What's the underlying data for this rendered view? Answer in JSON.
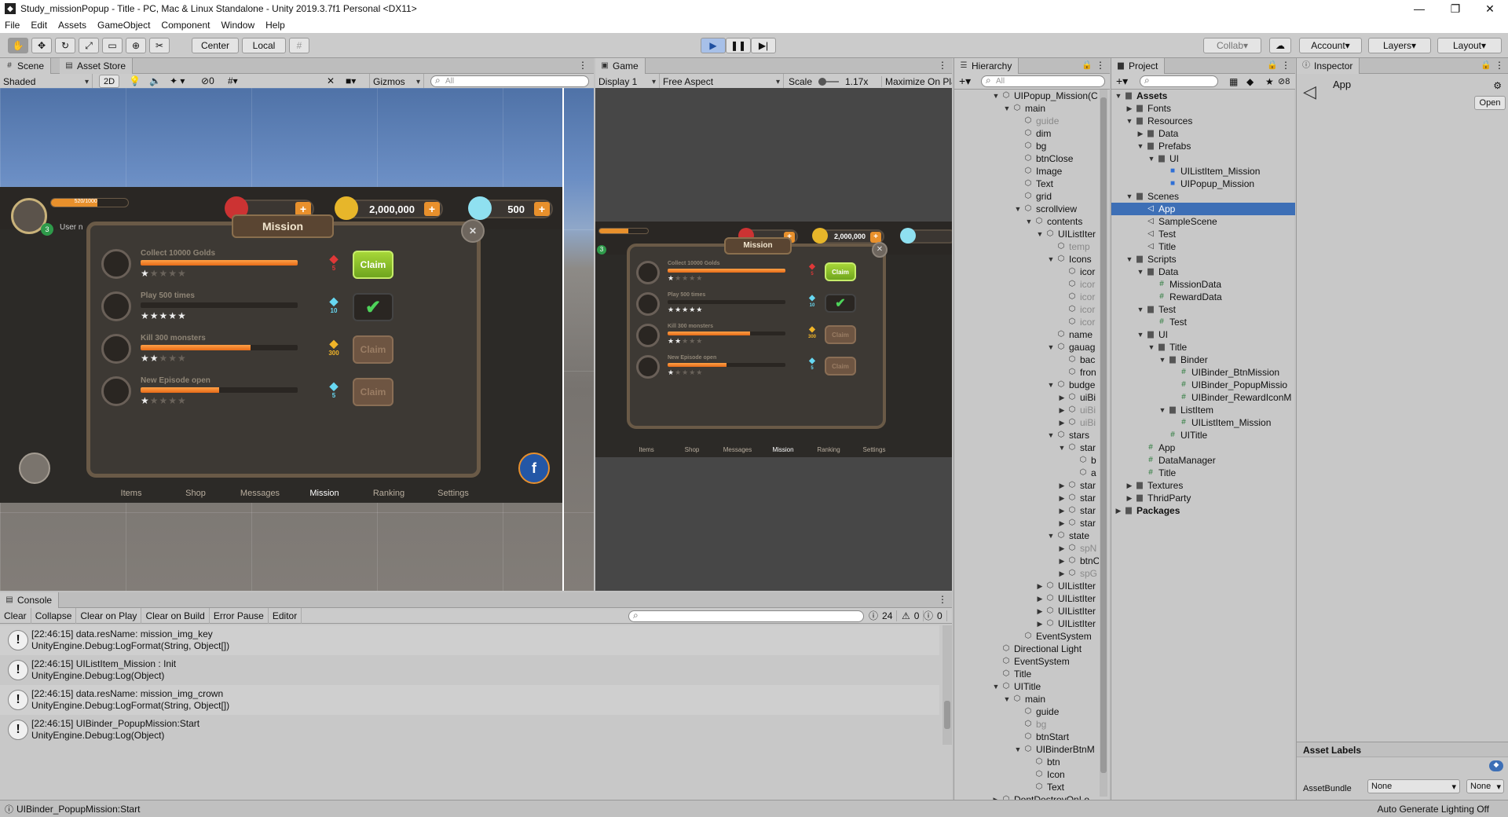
{
  "window": {
    "title": "Study_missionPopup - Title - PC, Mac & Linux Standalone - Unity 2019.3.7f1 Personal <DX11>"
  },
  "menu": [
    "File",
    "Edit",
    "Assets",
    "GameObject",
    "Component",
    "Window",
    "Help"
  ],
  "toolbar": {
    "pivot": "Center",
    "space": "Local",
    "collab": "Collab",
    "account": "Account",
    "layers": "Layers",
    "layout": "Layout"
  },
  "scene": {
    "tab": "Scene",
    "tab2": "Asset Store",
    "shading": "Shaded",
    "mode2d": "2D",
    "hidden": "0",
    "gizmos": "Gizmos",
    "search": "All"
  },
  "game": {
    "tab": "Game",
    "display": "Display 1",
    "aspect": "Free Aspect",
    "scale_label": "Scale",
    "scale_value": "1.17x",
    "maximize": "Maximize On Pla"
  },
  "ui_preview": {
    "gold": "2,000,000",
    "gems": "500",
    "hp": "520/1000",
    "level": "3",
    "username": "User n",
    "popup_title": "Mission",
    "missions": [
      {
        "name": "Collect 10000 Golds",
        "progress": 1.0,
        "stars": 1,
        "reward": "5",
        "button": "Claim",
        "state": "on"
      },
      {
        "name": "Play 500 times",
        "progress": 0.0,
        "stars": 5,
        "reward": "10",
        "button": "",
        "state": "done"
      },
      {
        "name": "Kill 300 monsters",
        "progress": 0.7,
        "stars": 2,
        "reward": "300",
        "button": "Claim",
        "state": "off"
      },
      {
        "name": "New Episode open",
        "progress": 0.5,
        "stars": 1,
        "reward": "5",
        "button": "Claim",
        "state": "off"
      }
    ],
    "nav": [
      "Items",
      "Shop",
      "Messages",
      "Mission",
      "Ranking",
      "Settings"
    ]
  },
  "hierarchy": {
    "tab": "Hierarchy",
    "search": "All",
    "items": [
      {
        "label": "UIPopup_Mission(C",
        "d": 0,
        "arrow": "open"
      },
      {
        "label": "main",
        "d": 1,
        "arrow": "open"
      },
      {
        "label": "guide",
        "d": 2,
        "dim": true
      },
      {
        "label": "dim",
        "d": 2
      },
      {
        "label": "bg",
        "d": 2
      },
      {
        "label": "btnClose",
        "d": 2
      },
      {
        "label": "Image",
        "d": 2
      },
      {
        "label": "Text",
        "d": 2
      },
      {
        "label": "grid",
        "d": 2
      },
      {
        "label": "scrollview",
        "d": 2,
        "arrow": "open"
      },
      {
        "label": "contents",
        "d": 3,
        "arrow": "open"
      },
      {
        "label": "UIListIter",
        "d": 4,
        "arrow": "open"
      },
      {
        "label": "temp",
        "d": 5,
        "dim": true
      },
      {
        "label": "Icons",
        "d": 5,
        "arrow": "open"
      },
      {
        "label": "icor",
        "d": 6
      },
      {
        "label": "icor",
        "d": 6,
        "dim": true
      },
      {
        "label": "icor",
        "d": 6,
        "dim": true
      },
      {
        "label": "icor",
        "d": 6,
        "dim": true
      },
      {
        "label": "icor",
        "d": 6,
        "dim": true
      },
      {
        "label": "name",
        "d": 5
      },
      {
        "label": "gauag",
        "d": 5,
        "arrow": "open"
      },
      {
        "label": "bac",
        "d": 6
      },
      {
        "label": "fron",
        "d": 6
      },
      {
        "label": "budge",
        "d": 5,
        "arrow": "open"
      },
      {
        "label": "uiBi",
        "d": 6,
        "arrow": "closed"
      },
      {
        "label": "uiBi",
        "d": 6,
        "arrow": "closed",
        "dim": true
      },
      {
        "label": "uiBi",
        "d": 6,
        "arrow": "closed",
        "dim": true
      },
      {
        "label": "stars",
        "d": 5,
        "arrow": "open"
      },
      {
        "label": "star",
        "d": 6,
        "arrow": "open"
      },
      {
        "label": "b",
        "d": 7
      },
      {
        "label": "a",
        "d": 7
      },
      {
        "label": "star",
        "d": 6,
        "arrow": "closed"
      },
      {
        "label": "star",
        "d": 6,
        "arrow": "closed"
      },
      {
        "label": "star",
        "d": 6,
        "arrow": "closed"
      },
      {
        "label": "star",
        "d": 6,
        "arrow": "closed"
      },
      {
        "label": "state",
        "d": 5,
        "arrow": "open"
      },
      {
        "label": "spN",
        "d": 6,
        "arrow": "closed",
        "dim": true
      },
      {
        "label": "btnC",
        "d": 6,
        "arrow": "closed"
      },
      {
        "label": "spG",
        "d": 6,
        "arrow": "closed",
        "dim": true
      },
      {
        "label": "UIListIter",
        "d": 4,
        "arrow": "closed"
      },
      {
        "label": "UIListIter",
        "d": 4,
        "arrow": "closed"
      },
      {
        "label": "UIListIter",
        "d": 4,
        "arrow": "closed"
      },
      {
        "label": "UIListIter",
        "d": 4,
        "arrow": "closed"
      },
      {
        "label": "EventSystem",
        "d": 2
      },
      {
        "label": "Directional Light",
        "d": 0
      },
      {
        "label": "EventSystem",
        "d": 0
      },
      {
        "label": "Title",
        "d": 0
      },
      {
        "label": "UITitle",
        "d": 0,
        "arrow": "open"
      },
      {
        "label": "main",
        "d": 1,
        "arrow": "open"
      },
      {
        "label": "guide",
        "d": 2
      },
      {
        "label": "bg",
        "d": 2,
        "dim": true
      },
      {
        "label": "btnStart",
        "d": 2
      },
      {
        "label": "UIBinderBtnM",
        "d": 2,
        "arrow": "open"
      },
      {
        "label": "btn",
        "d": 3
      },
      {
        "label": "Icon",
        "d": 3
      },
      {
        "label": "Text",
        "d": 3
      },
      {
        "label": "DontDestroyOnLo",
        "d": 0,
        "arrow": "closed"
      }
    ]
  },
  "project": {
    "tab": "Project",
    "hidden_count": "8",
    "items": [
      {
        "label": "Assets",
        "d": 0,
        "arrow": "open",
        "kind": "folder",
        "bold": true
      },
      {
        "label": "Fonts",
        "d": 1,
        "arrow": "closed",
        "kind": "folder"
      },
      {
        "label": "Resources",
        "d": 1,
        "arrow": "open",
        "kind": "folder"
      },
      {
        "label": "Data",
        "d": 2,
        "arrow": "closed",
        "kind": "folder"
      },
      {
        "label": "Prefabs",
        "d": 2,
        "arrow": "open",
        "kind": "folder"
      },
      {
        "label": "UI",
        "d": 3,
        "arrow": "open",
        "kind": "folder"
      },
      {
        "label": "UIListItem_Mission",
        "d": 4,
        "kind": "prefab"
      },
      {
        "label": "UIPopup_Mission",
        "d": 4,
        "kind": "prefab"
      },
      {
        "label": "Scenes",
        "d": 1,
        "arrow": "open",
        "kind": "folder"
      },
      {
        "label": "App",
        "d": 2,
        "kind": "scene",
        "sel": true
      },
      {
        "label": "SampleScene",
        "d": 2,
        "kind": "scene"
      },
      {
        "label": "Test",
        "d": 2,
        "kind": "scene"
      },
      {
        "label": "Title",
        "d": 2,
        "kind": "scene"
      },
      {
        "label": "Scripts",
        "d": 1,
        "arrow": "open",
        "kind": "folder"
      },
      {
        "label": "Data",
        "d": 2,
        "arrow": "open",
        "kind": "folder"
      },
      {
        "label": "MissionData",
        "d": 3,
        "kind": "script"
      },
      {
        "label": "RewardData",
        "d": 3,
        "kind": "script"
      },
      {
        "label": "Test",
        "d": 2,
        "arrow": "open",
        "kind": "folder"
      },
      {
        "label": "Test",
        "d": 3,
        "kind": "script"
      },
      {
        "label": "UI",
        "d": 2,
        "arrow": "open",
        "kind": "folder"
      },
      {
        "label": "Title",
        "d": 3,
        "arrow": "open",
        "kind": "folder"
      },
      {
        "label": "Binder",
        "d": 4,
        "arrow": "open",
        "kind": "folder"
      },
      {
        "label": "UIBinder_BtnMission",
        "d": 5,
        "kind": "script"
      },
      {
        "label": "UIBinder_PopupMissio",
        "d": 5,
        "kind": "script"
      },
      {
        "label": "UIBinder_RewardIconM",
        "d": 5,
        "kind": "script"
      },
      {
        "label": "ListItem",
        "d": 4,
        "arrow": "open",
        "kind": "folder"
      },
      {
        "label": "UIListItem_Mission",
        "d": 5,
        "kind": "script"
      },
      {
        "label": "UITitle",
        "d": 4,
        "kind": "script"
      },
      {
        "label": "App",
        "d": 2,
        "kind": "script"
      },
      {
        "label": "DataManager",
        "d": 2,
        "kind": "script"
      },
      {
        "label": "Title",
        "d": 2,
        "kind": "script"
      },
      {
        "label": "Textures",
        "d": 1,
        "arrow": "closed",
        "kind": "folder"
      },
      {
        "label": "ThridParty",
        "d": 1,
        "arrow": "closed",
        "kind": "folder"
      },
      {
        "label": "Packages",
        "d": 0,
        "arrow": "closed",
        "kind": "folder",
        "bold": true
      }
    ]
  },
  "inspector": {
    "tab": "Inspector",
    "object": "App",
    "open": "Open",
    "asset_labels": "Asset Labels",
    "assetbundle_label": "AssetBundle",
    "assetbundle_value": "None",
    "variant_value": "None"
  },
  "console": {
    "tab": "Console",
    "buttons": [
      "Clear",
      "Collapse",
      "Clear on Play",
      "Clear on Build",
      "Error Pause",
      "Editor"
    ],
    "count_log": "24",
    "count_warn": "0",
    "count_err": "0",
    "entries": [
      {
        "l1": "[22:46:15] data.resName: mission_img_key",
        "l2": "UnityEngine.Debug:LogFormat(String, Object[])"
      },
      {
        "l1": "[22:46:15] UIListItem_Mission : Init",
        "l2": "UnityEngine.Debug:Log(Object)"
      },
      {
        "l1": "[22:46:15] data.resName: mission_img_crown",
        "l2": "UnityEngine.Debug:LogFormat(String, Object[])"
      },
      {
        "l1": "[22:46:15] UIBinder_PopupMission:Start",
        "l2": "UnityEngine.Debug:Log(Object)"
      }
    ]
  },
  "status": {
    "message": "UIBinder_PopupMission:Start",
    "right": "Auto Generate Lighting Off"
  },
  "colors": {
    "selection": "#3d6fb6",
    "accent_orange": "#e8902c",
    "claim_green": "#8bc32c"
  }
}
